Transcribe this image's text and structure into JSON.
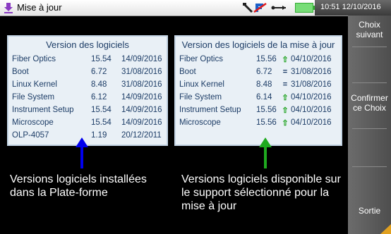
{
  "window": {
    "title": "Mise à jour"
  },
  "status": {
    "time": "10:51",
    "date": "12/10/2016"
  },
  "installed": {
    "title": "Version des logiciels",
    "rows": [
      {
        "name": "Fiber Optics",
        "version": "15.54",
        "date": "14/09/2016"
      },
      {
        "name": "Boot",
        "version": "6.72",
        "date": "31/08/2016"
      },
      {
        "name": "Linux Kernel",
        "version": "8.48",
        "date": "31/08/2016"
      },
      {
        "name": "File System",
        "version": "6.12",
        "date": "14/09/2016"
      },
      {
        "name": "Instrument Setup",
        "version": "15.54",
        "date": "14/09/2016"
      },
      {
        "name": "Microscope",
        "version": "15.54",
        "date": "14/09/2016"
      },
      {
        "name": "OLP-4057",
        "version": "1.19",
        "date": "20/12/2011"
      }
    ]
  },
  "update": {
    "title": "Version des logiciels de la mise à jour",
    "rows": [
      {
        "name": "Fiber Optics",
        "version": "15.56",
        "indicator": "up",
        "date": "04/10/2016"
      },
      {
        "name": "Boot",
        "version": "6.72",
        "indicator": "equal",
        "date": "31/08/2016"
      },
      {
        "name": "Linux Kernel",
        "version": "8.48",
        "indicator": "equal",
        "date": "31/08/2016"
      },
      {
        "name": "File System",
        "version": "6.14",
        "indicator": "up",
        "date": "04/10/2016"
      },
      {
        "name": "Instrument Setup",
        "version": "15.56",
        "indicator": "up",
        "date": "04/10/2016"
      },
      {
        "name": "Microscope",
        "version": "15.56",
        "indicator": "up",
        "date": "04/10/2016"
      }
    ]
  },
  "annotations": {
    "installed": "Versions logiciels installées dans la Plate-forme",
    "update": "Versions logiciels disponible sur le support sélectionné pour la mise à jour"
  },
  "sidebar": {
    "next": "Choix suivant",
    "confirm": "Confirmer ce Choix",
    "exit": "Sortie"
  },
  "colors": {
    "installed_arrow": "#0000ee",
    "update_arrow": "#1faa1f"
  }
}
